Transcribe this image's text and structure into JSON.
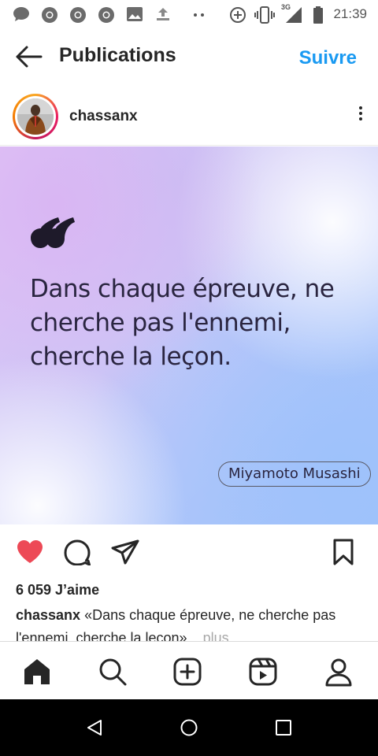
{
  "status_bar": {
    "network_label": "3G",
    "time": "21:39"
  },
  "header": {
    "title": "Publications",
    "follow_label": "Suivre"
  },
  "post": {
    "username": "chassanx",
    "image": {
      "quote_lines": [
        "Dans chaque épreuve, ne",
        "cherche pas l'ennemi,",
        "cherche la leçon."
      ],
      "author": "Miyamoto Musashi"
    },
    "liked": true,
    "likes_text": "6 059 J’aime",
    "caption_username": "chassanx",
    "caption_text": "«Dans chaque épreuve, ne cherche pas l'ennemi, cherche la leçon»",
    "more_label": "... plus"
  },
  "colors": {
    "accent": "#1a9af2",
    "like_red": "#ed4956",
    "text": "#262626"
  },
  "icons": {
    "status": [
      "chat-bubble-icon",
      "chrome-icon",
      "chrome-icon",
      "chrome-icon",
      "image-icon",
      "upload-icon",
      "more-dots-icon",
      "data-saver-icon",
      "vibrate-icon",
      "signal-icon",
      "battery-icon"
    ],
    "actions": [
      "heart-icon",
      "comment-icon",
      "share-icon",
      "bookmark-icon"
    ],
    "nav": [
      "home-icon",
      "search-icon",
      "add-post-icon",
      "reels-icon",
      "profile-icon"
    ],
    "system": [
      "back-triangle-icon",
      "home-circle-icon",
      "recents-square-icon"
    ]
  }
}
